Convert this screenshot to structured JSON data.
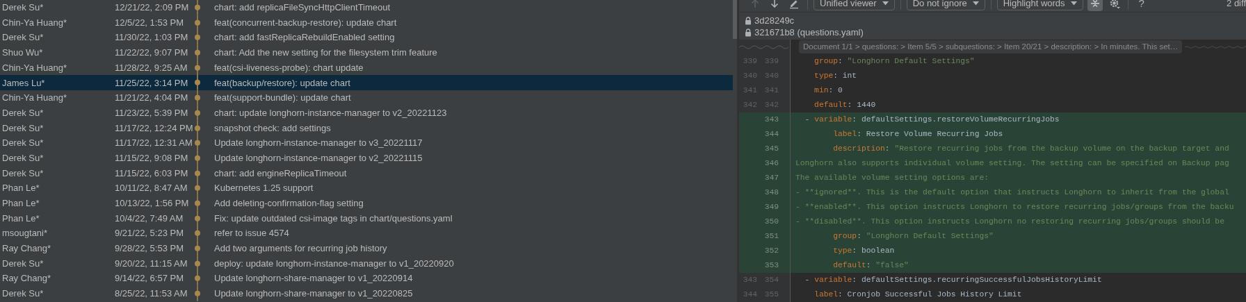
{
  "commit_log": {
    "rows": [
      {
        "author": "Derek Su*",
        "date": "12/21/22, 2:09 PM",
        "message": "chart: add replicaFileSyncHttpClientTimeout",
        "selected": false
      },
      {
        "author": "Chin-Ya Huang*",
        "date": "12/5/22, 1:53 PM",
        "message": "feat(concurrent-backup-restore): update chart",
        "selected": false
      },
      {
        "author": "Derek Su*",
        "date": "11/30/22, 1:03 PM",
        "message": "chart: add fastReplicaRebuildEnabled setting",
        "selected": false
      },
      {
        "author": "Shuo Wu*",
        "date": "11/22/22, 9:07 PM",
        "message": "chart: Add the new setting for the filesystem trim feature",
        "selected": false
      },
      {
        "author": "Chin-Ya Huang*",
        "date": "11/28/22, 9:25 AM",
        "message": "feat(csi-liveness-probe): chart update",
        "selected": false
      },
      {
        "author": "James Lu*",
        "date": "11/25/22, 3:14 PM",
        "message": "feat(backup/restore): update chart",
        "selected": true
      },
      {
        "author": "Chin-Ya Huang*",
        "date": "11/21/22, 4:04 PM",
        "message": "feat(support-bundle): update chart",
        "selected": false
      },
      {
        "author": "Derek Su*",
        "date": "11/23/22, 5:39 PM",
        "message": "chart: update longhorn-instance-manager to v2_20221123",
        "selected": false
      },
      {
        "author": "Derek Su*",
        "date": "11/17/22, 12:24 PM",
        "message": "snapshot check: add settings",
        "selected": false
      },
      {
        "author": "Derek Su*",
        "date": "11/17/22, 12:31 AM",
        "message": "Update longhorn-instance-manager to v3_20221117",
        "selected": false
      },
      {
        "author": "Derek Su*",
        "date": "11/15/22, 9:08 PM",
        "message": "Update longhorn-instance-manager to v2_20221115",
        "selected": false
      },
      {
        "author": "Derek Su*",
        "date": "11/15/22, 6:03 PM",
        "message": "chart: add engineReplicaTimeout",
        "selected": false
      },
      {
        "author": "Phan Le*",
        "date": "10/11/22, 8:47 AM",
        "message": "Kubernetes 1.25 support",
        "selected": false
      },
      {
        "author": "Phan Le*",
        "date": "10/13/22, 1:56 PM",
        "message": "Add deleting-confirmation-flag setting",
        "selected": false
      },
      {
        "author": "Phan Le*",
        "date": "10/4/22, 7:49 AM",
        "message": "Fix: update outdated csi-image tags in chart/questions.yaml",
        "selected": false
      },
      {
        "author": "msougtani*",
        "date": "9/21/22, 5:23 PM",
        "message": "refer to issue 4574",
        "selected": false
      },
      {
        "author": "Ray Chang*",
        "date": "9/28/22, 5:53 PM",
        "message": "Add two arguments for recurring job history",
        "selected": false
      },
      {
        "author": "Derek Su*",
        "date": "9/20/22, 11:15 AM",
        "message": "deploy: update longhorn-instance-manager to v1_20220920",
        "selected": false
      },
      {
        "author": "Ray Chang*",
        "date": "9/14/22, 6:57 PM",
        "message": "Update longhorn-share-manager to v1_20220914",
        "selected": false
      },
      {
        "author": "Derek Su*",
        "date": "8/25/22, 11:53 AM",
        "message": "Update longhorn-share-manager to v1_20220825",
        "selected": false
      }
    ]
  },
  "diff_viewer": {
    "toolbar": {
      "previous_difference": {
        "disabled": true
      },
      "next_difference": {
        "disabled": false
      },
      "dropdowns": [
        "Unified viewer",
        "Do not ignore",
        "Highlight words"
      ],
      "collapse_toggle": {
        "selected": true
      },
      "help": "?",
      "diff_count": "2 diff"
    },
    "revisions": [
      "3d28249c",
      "321671b8 (questions.yaml)"
    ],
    "breadcrumb": "Document 1/1 > questions: > Item 5/5 > subquestions: > Item 20/21 > description: > In minutes. This set…",
    "lines": [
      {
        "old": "339",
        "new": "339",
        "changed": false,
        "tokens": [
          {
            "kind": "key",
            "text": "    group"
          },
          {
            "kind": "punct",
            "text": ": "
          },
          {
            "kind": "string",
            "text": "\"Longhorn Default Settings\""
          }
        ]
      },
      {
        "old": "340",
        "new": "340",
        "changed": false,
        "tokens": [
          {
            "kind": "key",
            "text": "    type"
          },
          {
            "kind": "punct",
            "text": ": "
          },
          {
            "kind": "plain",
            "text": "int"
          }
        ]
      },
      {
        "old": "341",
        "new": "341",
        "changed": false,
        "tokens": [
          {
            "kind": "key",
            "text": "    min"
          },
          {
            "kind": "punct",
            "text": ": "
          },
          {
            "kind": "plain",
            "text": "0"
          }
        ]
      },
      {
        "old": "342",
        "new": "342",
        "changed": false,
        "tokens": [
          {
            "kind": "key",
            "text": "    default"
          },
          {
            "kind": "punct",
            "text": ": "
          },
          {
            "kind": "plain",
            "text": "1440"
          }
        ]
      },
      {
        "new": "343",
        "changed": true,
        "tokens": [
          {
            "kind": "punct",
            "text": "  - "
          },
          {
            "kind": "key",
            "text": "variable"
          },
          {
            "kind": "punct",
            "text": ": "
          },
          {
            "kind": "plain",
            "text": "defaultSettings.restoreVolumeRecurringJobs"
          }
        ]
      },
      {
        "new": "344",
        "changed": true,
        "tokens": [
          {
            "kind": "key",
            "text": "        label"
          },
          {
            "kind": "punct",
            "text": ": "
          },
          {
            "kind": "plain",
            "text": "Restore Volume Recurring Jobs"
          }
        ]
      },
      {
        "new": "345",
        "changed": true,
        "tokens": [
          {
            "kind": "key",
            "text": "        description"
          },
          {
            "kind": "punct",
            "text": ": "
          },
          {
            "kind": "string",
            "text": "\"Restore recurring jobs from the backup volume on the backup target and"
          }
        ]
      },
      {
        "new": "346",
        "changed": true,
        "tokens": [
          {
            "kind": "string",
            "text": "Longhorn also supports individual volume setting. The setting can be specified on Backup pag"
          }
        ]
      },
      {
        "new": "347",
        "changed": true,
        "tokens": [
          {
            "kind": "string",
            "text": "The available volume setting options are:"
          }
        ]
      },
      {
        "new": "348",
        "changed": true,
        "tokens": [
          {
            "kind": "string",
            "text": "- **ignored**. This is the default option that instructs Longhorn to inherit from the global"
          }
        ]
      },
      {
        "new": "349",
        "changed": true,
        "tokens": [
          {
            "kind": "string",
            "text": "- **enabled**. This option instructs Longhorn to restore recurring jobs/groups from the backu"
          }
        ]
      },
      {
        "new": "350",
        "changed": true,
        "tokens": [
          {
            "kind": "string",
            "text": "- **disabled**. This option instructs Longhorn no restoring recurring jobs/groups should be"
          }
        ]
      },
      {
        "new": "351",
        "changed": true,
        "tokens": [
          {
            "kind": "key",
            "text": "        group"
          },
          {
            "kind": "punct",
            "text": ": "
          },
          {
            "kind": "string",
            "text": "\"Longhorn Default Settings\""
          }
        ]
      },
      {
        "new": "352",
        "changed": true,
        "tokens": [
          {
            "kind": "key",
            "text": "        type"
          },
          {
            "kind": "punct",
            "text": ": "
          },
          {
            "kind": "plain",
            "text": "boolean"
          }
        ]
      },
      {
        "new": "353",
        "changed": true,
        "tokens": [
          {
            "kind": "key",
            "text": "        default"
          },
          {
            "kind": "punct",
            "text": ": "
          },
          {
            "kind": "string",
            "text": "\"false\""
          }
        ]
      },
      {
        "old": "343",
        "new": "354",
        "changed": false,
        "tokens": [
          {
            "kind": "punct",
            "text": "  - "
          },
          {
            "kind": "key",
            "text": "variable"
          },
          {
            "kind": "punct",
            "text": ": "
          },
          {
            "kind": "plain",
            "text": "defaultSettings.recurringSuccessfulJobsHistoryLimit"
          }
        ]
      },
      {
        "old": "344",
        "new": "355",
        "changed": false,
        "tokens": [
          {
            "kind": "key",
            "text": "    label"
          },
          {
            "kind": "punct",
            "text": ": "
          },
          {
            "kind": "plain",
            "text": "Cronjob Successful Jobs History Limit"
          }
        ]
      }
    ]
  }
}
